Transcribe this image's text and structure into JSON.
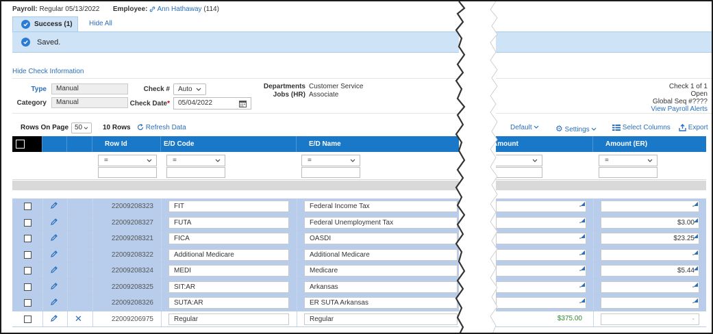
{
  "header": {
    "payroll_label": "Payroll:",
    "payroll_value": "Regular 05/13/2022",
    "employee_label": "Employee:",
    "employee_name": "Ann Hathaway",
    "employee_id": "(114)"
  },
  "alerts": {
    "tab_label": "Success (1)",
    "hide_all": "Hide All",
    "message": "Saved."
  },
  "check_info": {
    "hide_link": "Hide Check Information",
    "type_label": "Type",
    "type_value": "Manual",
    "category_label": "Category",
    "category_value": "Manual",
    "check_num_label": "Check #",
    "check_num_value": "Auto",
    "check_date_label": "Check Date",
    "check_date_required": "*",
    "check_date_value": "05/04/2022",
    "departments_label": "Departments",
    "departments_value": "Customer Service",
    "jobs_label": "Jobs (HR)",
    "jobs_value": "Associate",
    "check_of": "Check 1 of 1",
    "status": "Open",
    "global_seq": "Global Seq #????",
    "view_alerts": "View Payroll Alerts"
  },
  "toolbar": {
    "rows_on_page_label": "Rows On Page",
    "rows_on_page_value": "50",
    "rows_count": "10 Rows",
    "refresh": "Refresh Data",
    "default_view": "Default",
    "settings": "Settings",
    "select_columns": "Select Columns",
    "export": "Export"
  },
  "grid": {
    "columns": {
      "row_id": "Row Id",
      "ed_code": "E/D Code",
      "ed_name": "E/D Name",
      "amount": "Amount",
      "amount_er": "Amount (ER)"
    },
    "filter_op": "=",
    "rows": [
      {
        "row_id": "22009208323",
        "ed_code": "FIT",
        "ed_name": "Federal Income Tax",
        "amount": "-",
        "amount_er": "-"
      },
      {
        "row_id": "22009208327",
        "ed_code": "FUTA",
        "ed_name": "Federal Unemployment Tax",
        "amount": "-",
        "amount_er": "$3.00"
      },
      {
        "row_id": "22009208321",
        "ed_code": "FICA",
        "ed_name": "OASDI",
        "amount": "-",
        "amount_er": "$23.25"
      },
      {
        "row_id": "22009208322",
        "ed_code": "Additional Medicare",
        "ed_name": "Additional Medicare",
        "amount": "-",
        "amount_er": "-"
      },
      {
        "row_id": "22009208324",
        "ed_code": "MEDI",
        "ed_name": "Medicare",
        "amount": "-",
        "amount_er": "$5.44"
      },
      {
        "row_id": "22009208325",
        "ed_code": "SIT:AR",
        "ed_name": "Arkansas",
        "amount": "-",
        "amount_er": "-"
      },
      {
        "row_id": "22009208326",
        "ed_code": "SUTA:AR",
        "ed_name": "ER SUTA Arkansas",
        "amount": "-",
        "amount_er": "-"
      },
      {
        "row_id": "22009206975",
        "ed_code": "Regular",
        "ed_name": "Regular",
        "amount": "$375.00",
        "amount_er": "-"
      }
    ]
  },
  "colors": {
    "header_blue": "#1978c8",
    "alert_bg": "#cfe3f7",
    "selected_row": "#b8cdeb",
    "link": "#2a6ebb"
  }
}
